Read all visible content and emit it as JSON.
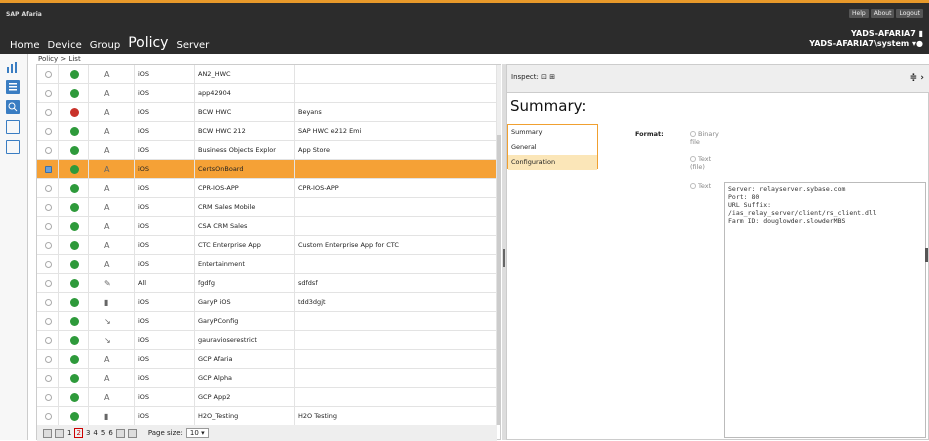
{
  "header": {
    "app_title": "SAP Afaria",
    "links": [
      "Help",
      "About",
      "Logout"
    ],
    "nav": [
      "Home",
      "Device",
      "Group",
      "Policy",
      "Server"
    ],
    "active_nav": "Policy",
    "user_line1": "YADS-AFARIA7",
    "user_line2": "YADS-AFARIA7\\system"
  },
  "breadcrumb": "Policy > List",
  "policies": [
    {
      "status": "ok",
      "os": "iOS",
      "name": "AN2_HWC",
      "desc": "",
      "selected": false
    },
    {
      "status": "ok",
      "os": "iOS",
      "name": "app42904",
      "desc": "",
      "selected": false
    },
    {
      "status": "no",
      "os": "iOS",
      "name": "BCW HWC",
      "desc": "Beyans",
      "selected": false
    },
    {
      "status": "ok",
      "os": "iOS",
      "name": "BCW HWC 212",
      "desc": "SAP HWC e212 Emi",
      "selected": false
    },
    {
      "status": "ok",
      "os": "iOS",
      "name": "Business Objects Explor",
      "desc": "App Store",
      "selected": false
    },
    {
      "status": "ok",
      "os": "iOS",
      "name": "CertsOnBoard",
      "desc": "",
      "selected": true
    },
    {
      "status": "ok",
      "os": "iOS",
      "name": "CPR-IOS-APP",
      "desc": "CPR-IOS-APP",
      "selected": false
    },
    {
      "status": "ok",
      "os": "iOS",
      "name": "CRM Sales Mobile",
      "desc": "",
      "selected": false
    },
    {
      "status": "ok",
      "os": "iOS",
      "name": "CSA CRM Sales",
      "desc": "",
      "selected": false
    },
    {
      "status": "ok",
      "os": "iOS",
      "name": "CTC Enterprise App",
      "desc": "Custom Enterprise App for CTC",
      "selected": false
    },
    {
      "status": "ok",
      "os": "iOS",
      "name": "Entertainment",
      "desc": "",
      "selected": false
    },
    {
      "status": "ok",
      "os": "All",
      "name": "fgdfg",
      "desc": "sdfdsf",
      "selected": false
    },
    {
      "status": "ok",
      "os": "iOS",
      "name": "GaryP iOS",
      "desc": "tdd3dgjt",
      "selected": false
    },
    {
      "status": "ok",
      "os": "iOS",
      "name": "GaryPConfig",
      "desc": "",
      "selected": false
    },
    {
      "status": "ok",
      "os": "iOS",
      "name": "gauravioserestrict",
      "desc": "",
      "selected": false
    },
    {
      "status": "ok",
      "os": "iOS",
      "name": "GCP Afaria",
      "desc": "",
      "selected": false
    },
    {
      "status": "ok",
      "os": "iOS",
      "name": "GCP Alpha",
      "desc": "",
      "selected": false
    },
    {
      "status": "ok",
      "os": "iOS",
      "name": "GCP App2",
      "desc": "",
      "selected": false
    },
    {
      "status": "ok",
      "os": "iOS",
      "name": "H2O_Testing",
      "desc": "H2O Testing",
      "selected": false
    }
  ],
  "pager": {
    "pages": [
      "1",
      "2",
      "3",
      "4",
      "5",
      "6"
    ],
    "current": "2",
    "page_size_label": "Page size:",
    "page_size": "10"
  },
  "inspect": {
    "label": "Inspect:",
    "title": "Summary:",
    "menu": [
      "Summary",
      "General",
      "Configuration"
    ],
    "menu_selected": "Configuration",
    "format_label": "Format:",
    "format_options": [
      "Binary file",
      "Text (file)",
      "Text"
    ],
    "output_lines": [
      "Server: relayserver.sybase.com",
      "Port: 80",
      "URL Suffix:",
      "/ias_relay_server/client/rs_client.dll",
      "Farm ID: douglowder.slowderMBS"
    ]
  },
  "colors": {
    "accent": "#e8992a",
    "selected_row": "#f5a136",
    "status_ok": "#2e9a3b",
    "status_no": "#c9322a",
    "topbar": "#2c2c2c"
  }
}
